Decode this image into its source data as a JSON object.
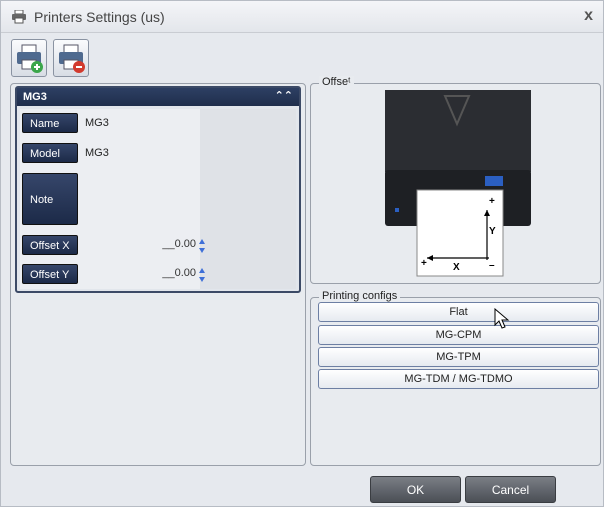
{
  "window": {
    "title": "Printers Settings (us)",
    "close_label": "x"
  },
  "toolbar": {
    "add_icon": "add-printer-icon",
    "remove_icon": "remove-printer-icon"
  },
  "printer_panel": {
    "header": "MG3",
    "fields": {
      "name_label": "Name",
      "name_value": "MG3",
      "model_label": "Model",
      "model_value": "MG3",
      "note_label": "Note",
      "note_value": "",
      "offset_x_label": "Offset X",
      "offset_x_value": "__0.00",
      "offset_y_label": "Offset Y",
      "offset_y_value": "__0.00"
    }
  },
  "offset": {
    "legend": "Offseᵗ",
    "diagram": {
      "y_label": "Y",
      "x_label": "X",
      "plus_top": "+",
      "minus_right": "–",
      "plus_left": "+"
    }
  },
  "configs": {
    "legend": "Printing configs",
    "items": [
      "Flat",
      "MG-CPM",
      "MG-TPM",
      "MG-TDM / MG-TDMO"
    ]
  },
  "footer": {
    "ok": "OK",
    "cancel": "Cancel"
  },
  "colors": {
    "panel_header": "#1f2e4c",
    "button_dark": "#4b4f56",
    "accent_green": "#3aa64a",
    "accent_red": "#d23a2e"
  }
}
